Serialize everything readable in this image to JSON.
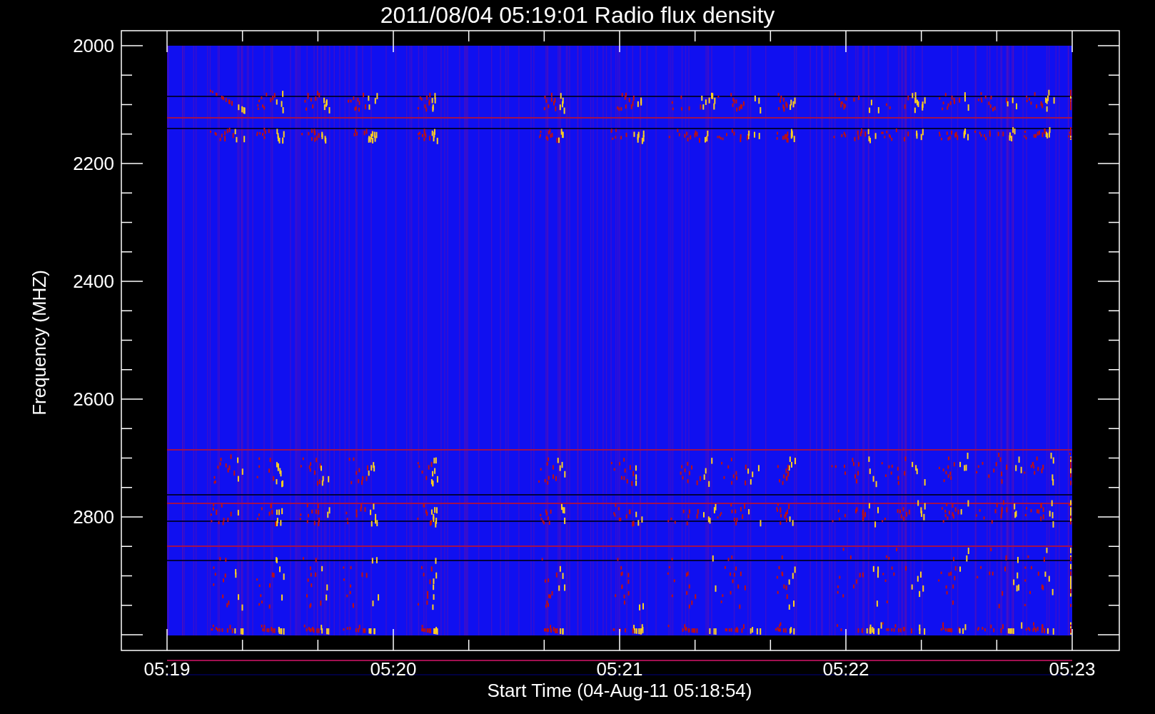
{
  "title": "2011/08/04 05:19:01 Radio flux density",
  "y_axis": {
    "label": "Frequency (MHZ)",
    "ticks": [
      "2000",
      "2200",
      "2400",
      "2600",
      "2800"
    ]
  },
  "x_axis": {
    "label": "Start Time (04-Aug-11 05:18:54)",
    "ticks": [
      "05:19",
      "05:20",
      "05:21",
      "05:22",
      "05:23"
    ]
  }
}
